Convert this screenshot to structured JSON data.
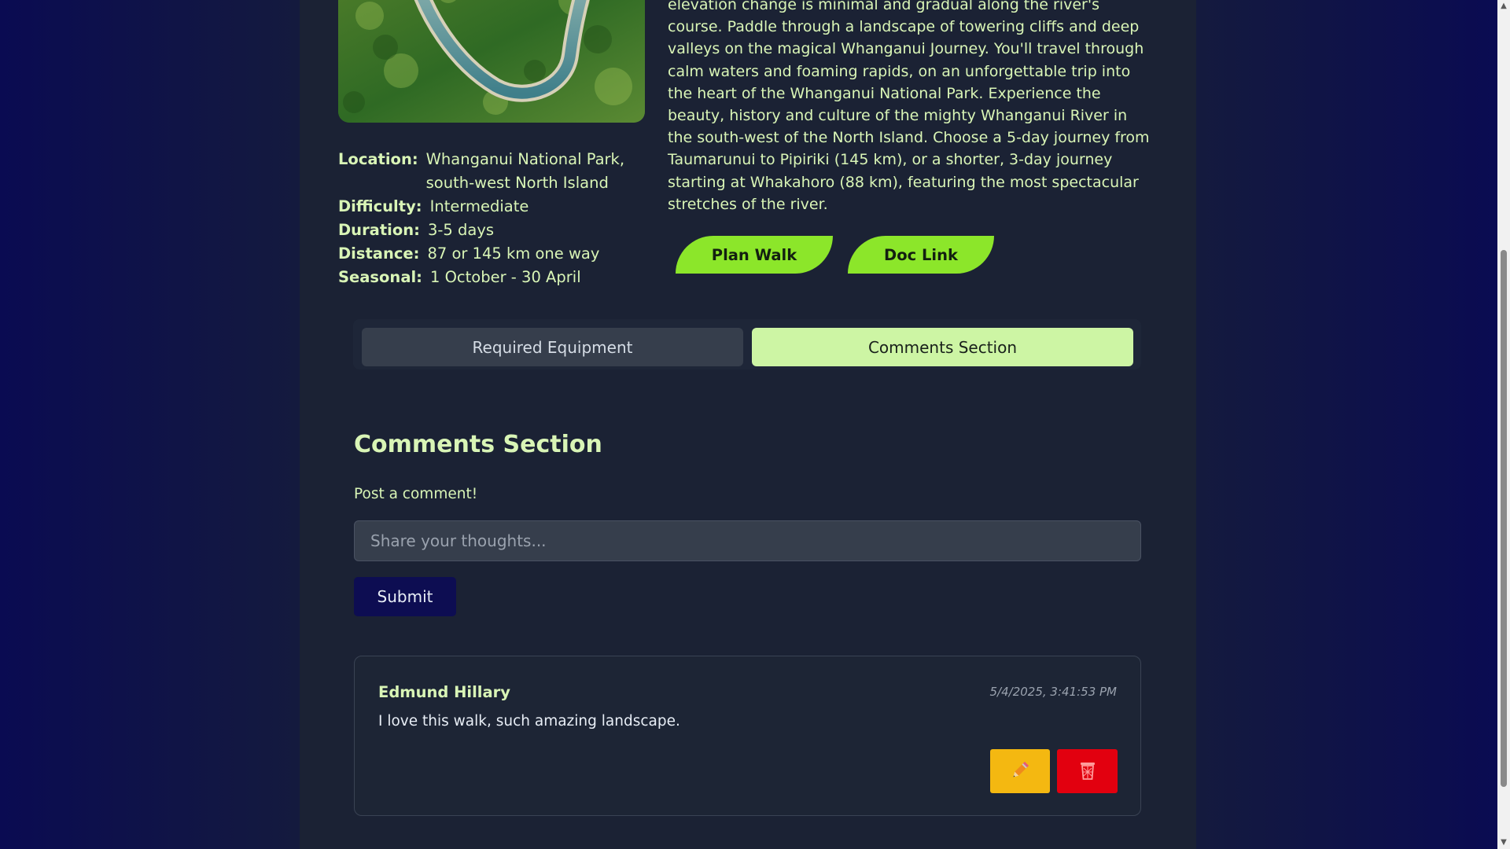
{
  "trail": {
    "info": [
      {
        "label": "Location:",
        "value": "Whanganui National Park, south-west North Island"
      },
      {
        "label": "Difficulty:",
        "value": "Intermediate"
      },
      {
        "label": "Duration:",
        "value": "3-5 days"
      },
      {
        "label": "Distance:",
        "value": "87 or 145 km one way"
      },
      {
        "label": "Seasonal:",
        "value": "1 October - 30 April"
      }
    ],
    "description": "elevation change is minimal and gradual along the river's course. Paddle through a landscape of towering cliffs and deep valleys on the magical Whanganui Journey. You'll travel through calm waters and foaming rapids, on an unforgettable trip into the heart of the Whanganui National Park. Experience the beauty, history and culture of the mighty Whanganui River in the south-west of the North Island. Choose a 5-day journey from Taumarunui to Pipiriki (145 km), or a shorter, 3-day journey starting at Whakahoro (88 km), featuring the most spectacular stretches of the river.",
    "plan_button": "Plan Walk",
    "doc_button": "Doc Link"
  },
  "tabs": {
    "equipment": "Required Equipment",
    "comments": "Comments Section"
  },
  "comments": {
    "title": "Comments Section",
    "post_label": "Post a comment!",
    "placeholder": "Share your thoughts...",
    "submit_label": "Submit",
    "items": [
      {
        "author": "Edmund Hillary",
        "date": "5/4/2025, 3:41:53 PM",
        "text": "I love this walk, such amazing landscape."
      }
    ]
  },
  "icons": {
    "edit": "pencil-icon",
    "delete": "trash-icon"
  },
  "colors": {
    "accent_green": "#8ce62a",
    "tab_active": "#cdf5a4",
    "edit_yellow": "#f4b811",
    "delete_red": "#e2000f",
    "submit_navy": "#0d0d52"
  }
}
